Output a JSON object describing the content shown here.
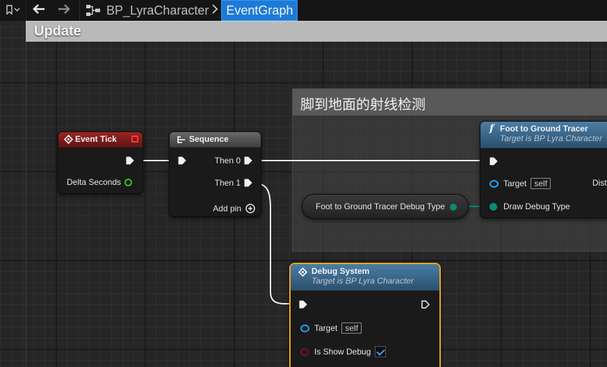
{
  "toolbar": {
    "blueprint_name": "BP_LyraCharacter",
    "graph_name": "EventGraph"
  },
  "comments": {
    "update": "Update",
    "ray_check": "脚到地面的射线检测"
  },
  "event_tick": {
    "title": "Event Tick",
    "delta_seconds": "Delta Seconds"
  },
  "sequence": {
    "title": "Sequence",
    "then0": "Then 0",
    "then1": "Then 1",
    "add_pin": "Add pin"
  },
  "foot_tracer": {
    "title": "Foot to Ground Tracer",
    "subtitle": "Target is BP Lyra Character",
    "target": "Target",
    "self": "self",
    "draw_debug": "Draw Debug Type",
    "dist_pin": "Dist"
  },
  "debug_type_var": {
    "label": "Foot to Ground Tracer Debug Type"
  },
  "debug_system": {
    "title": "Debug System",
    "subtitle": "Target is BP Lyra Character",
    "target": "Target",
    "self": "self",
    "is_show_debug": "Is Show Debug",
    "is_show_debug_checked": true
  },
  "colors": {
    "event_header": "#8c1e1e",
    "function_header": "#3d6b8f",
    "sequence_header": "#5a5a5a",
    "selection": "#f2a818",
    "object_pin": "#1ea4ff",
    "enum_pin": "#0a8a7a",
    "float_pin": "#35c41d",
    "bool_pin": "#8a0d0d",
    "breadcrumb_active": "#1c7bd8"
  },
  "icons": [
    "bookmark-icon",
    "back-arrow-icon",
    "forward-arrow-icon",
    "blueprint-icon",
    "event-icon",
    "sequence-icon",
    "function-icon"
  ]
}
